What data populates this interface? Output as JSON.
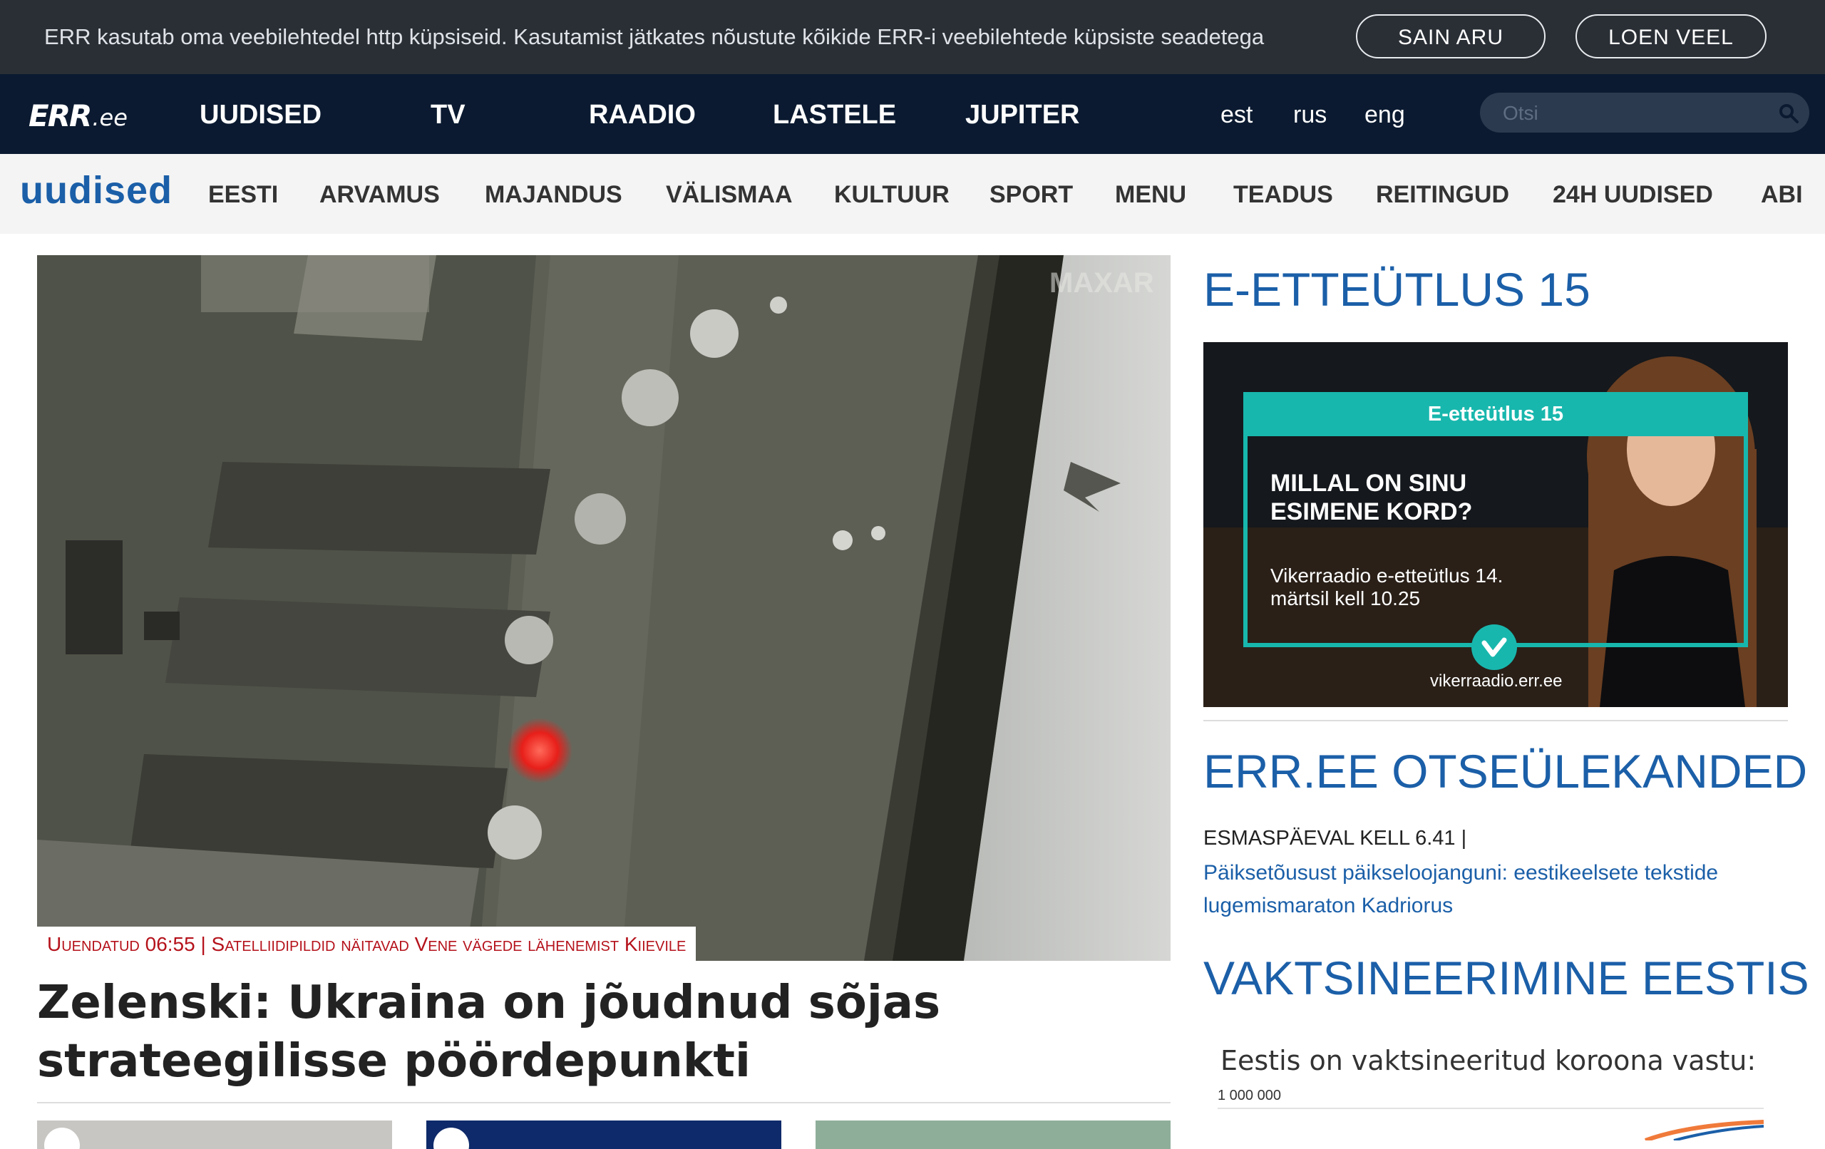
{
  "cookie": {
    "text": "ERR kasutab oma veebilehtedel http küpsiseid. Kasutamist jätkates nõustute kõikide ERR-i veebilehtede küpsiste seadetega",
    "accept_label": "SAIN ARU",
    "more_label": "LOEN VEEL"
  },
  "header": {
    "logo_mark": "ERR",
    "logo_tld": ".ee",
    "nav": [
      "UUDISED",
      "TV",
      "RAADIO",
      "LASTELE",
      "JUPITER"
    ],
    "languages": [
      "est",
      "rus",
      "eng"
    ],
    "search_placeholder": "Otsi",
    "search_value": ""
  },
  "subnav": {
    "title": "uudised",
    "items": [
      "EESTI",
      "ARVAMUS",
      "MAJANDUS",
      "VÄLISMAA",
      "KULTUUR",
      "SPORT",
      "MENU",
      "TEADUS",
      "REITINGUD",
      "24H UUDISED",
      "ABI"
    ]
  },
  "hero": {
    "caption": "Uuendatud 06:55 | Satelliidipildid näitavad Vene vägede lähenemist Kiievile",
    "headline": "Zelenski: Ukraina on jõudnud sõjas strateegilisse pöördepunkti",
    "watermark": "MAXAR"
  },
  "sidebar": {
    "promo_heading": "E-ETTEÜTLUS 15",
    "promo": {
      "tab": "E-etteütlus 15",
      "question": "MILLAL ON SINU ESIMENE KORD?",
      "subtitle": "Vikerraadio e-etteütlus 14. märtsil kell 10.25",
      "url": "vikerraadio.err.ee"
    },
    "live_heading": "ERR.EE OTSEÜLEKANDED",
    "live_time": "ESMASPÄEVAL KELL 6.41 |",
    "live_link": "Päiksetõusust päikseloojanguni: eestikeelsete tekstide lugemismaraton Kadriorus",
    "vacc_heading": "VAKTSINEERIMINE EESTIS",
    "vacc_label": "Eestis on vaktsineeritud koroona vastu:",
    "vacc_tick": "1 000 000"
  },
  "colors": {
    "brand_blue": "#1b5fa8",
    "nav_dark": "#0b1a30",
    "cookie_bg": "#2a2f36",
    "caption_red": "#b5121b",
    "promo_teal": "#18b7ad"
  }
}
